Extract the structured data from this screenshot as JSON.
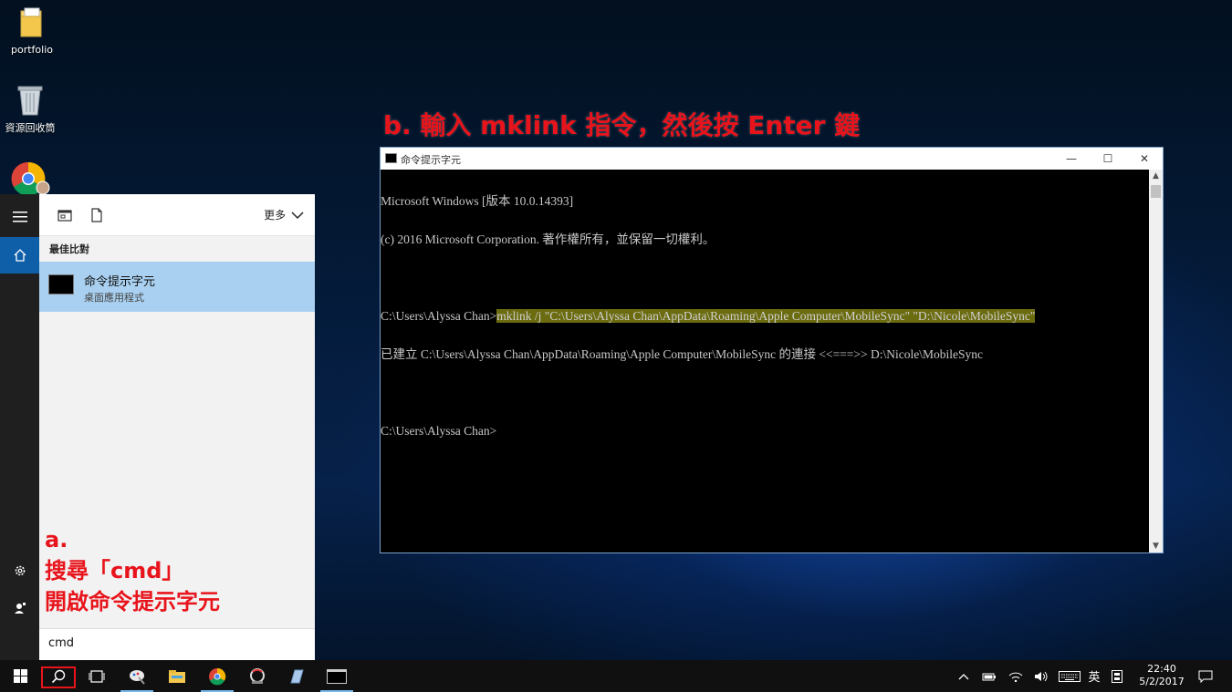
{
  "desktop": {
    "icons": [
      {
        "label": "portfolio",
        "icon": "folder-icon"
      },
      {
        "label": "資源回收筒",
        "icon": "recycle-bin-icon"
      },
      {
        "label": "",
        "icon": "chrome-user-icon"
      }
    ]
  },
  "annotations": {
    "b": "b. 輸入 mklink 指令，然後按 Enter 鍵",
    "a_line1": "a.",
    "a_line2": "搜尋「cmd」",
    "a_line3": "開啟命令提示字元"
  },
  "start_menu": {
    "more_label": "更多",
    "best_match_title": "最佳比對",
    "result": {
      "name": "命令提示字元",
      "subtitle": "桌面應用程式"
    },
    "search_value": "cmd"
  },
  "cmd_window": {
    "title": "命令提示字元",
    "controls": {
      "minimize": "—",
      "maximize": "☐",
      "close": "✕"
    },
    "lines": {
      "l1": "Microsoft Windows [版本 10.0.14393]",
      "l2": "(c) 2016 Microsoft Corporation. 著作權所有，並保留一切權利。",
      "l3": "",
      "l4_prompt": "C:\\Users\\Alyssa Chan>",
      "l4_command": "mklink /j \"C:\\Users\\Alyssa Chan\\AppData\\Roaming\\Apple Computer\\MobileSync\" \"D:\\Nicole\\MobileSync\"",
      "l5": "已建立 C:\\Users\\Alyssa Chan\\AppData\\Roaming\\Apple Computer\\MobileSync 的連接 <<===>> D:\\Nicole\\MobileSync",
      "l6": "",
      "l7": "C:\\Users\\Alyssa Chan>"
    },
    "highlight_color": "#6b6b10"
  },
  "taskbar": {
    "ime_label": "英",
    "time": "22:40",
    "date": "5/2/2017"
  },
  "colors": {
    "annotation": "#e8141c",
    "start_accent": "#0f5ea8",
    "selection": "#a9d0f0",
    "taskbar": "#101010"
  }
}
